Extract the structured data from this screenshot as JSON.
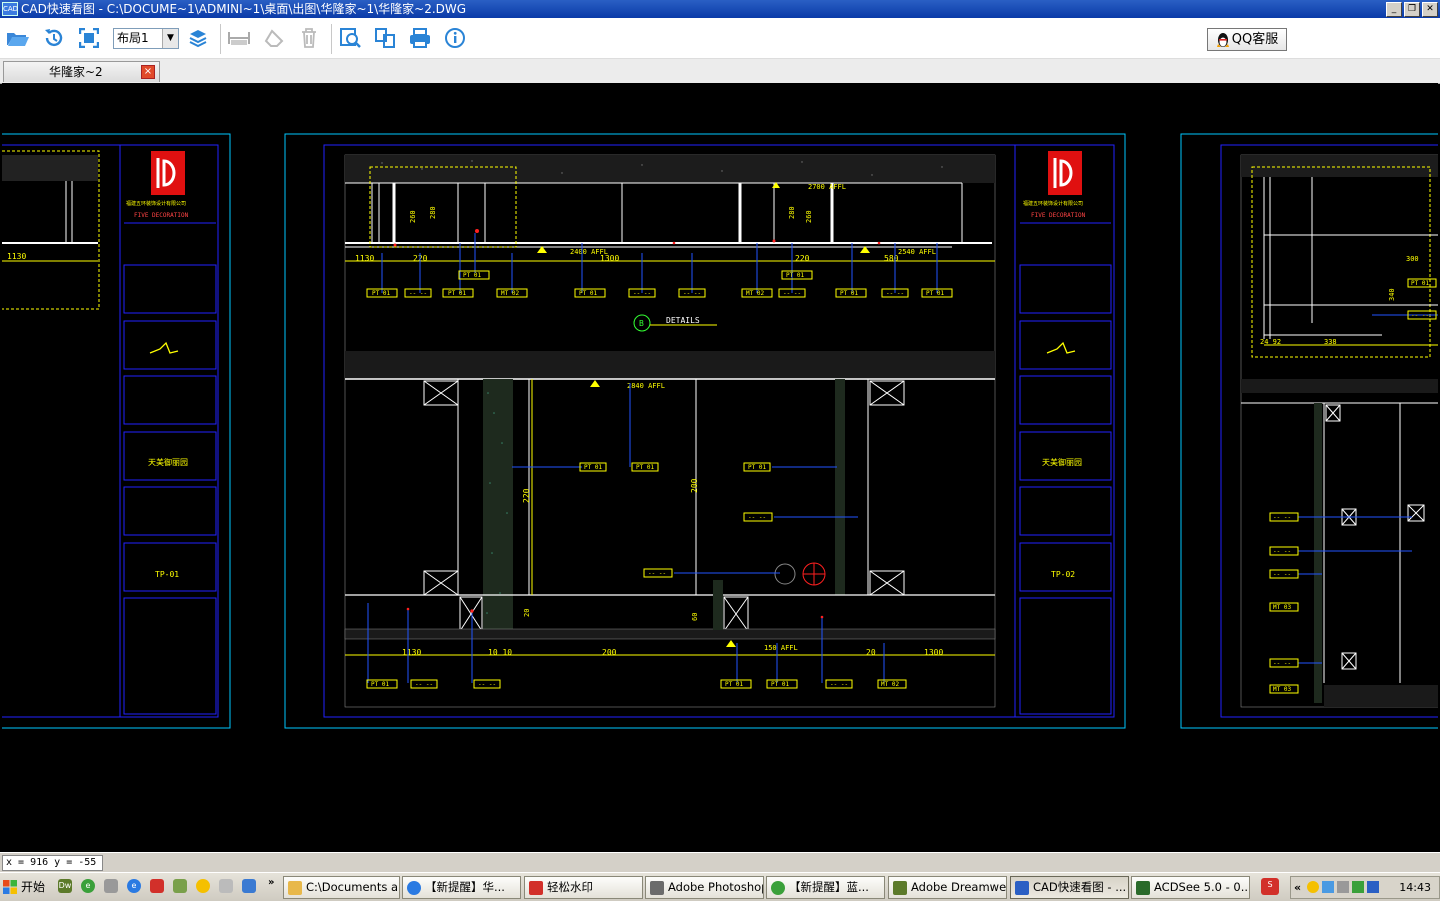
{
  "window": {
    "title": "CAD快速看图 - C:\\DOCUME~1\\ADMINI~1\\桌面\\出图\\华隆家~1\\华隆家~2.DWG",
    "app_icon": "CAD",
    "controls": [
      "minimize-icon",
      "restore-icon",
      "close-icon"
    ]
  },
  "toolbar": {
    "buttons": [
      {
        "name": "open-file",
        "icon": "folder-open-icon"
      },
      {
        "name": "refresh",
        "icon": "history-icon"
      },
      {
        "name": "fit-view",
        "icon": "fit-screen-icon"
      },
      {
        "name": "layers",
        "icon": "layers-icon"
      },
      {
        "name": "measure",
        "icon": "ruler-icon"
      },
      {
        "name": "erase",
        "icon": "eraser-icon"
      },
      {
        "name": "delete",
        "icon": "trash-icon"
      },
      {
        "name": "find-text",
        "icon": "search-text-icon"
      },
      {
        "name": "export",
        "icon": "export-icon"
      },
      {
        "name": "print",
        "icon": "printer-icon"
      },
      {
        "name": "about",
        "icon": "info-icon"
      }
    ],
    "layout_select": {
      "value": "布局1"
    },
    "qq_service": "QQ客服"
  },
  "tabs": [
    {
      "label": "华隆家~2",
      "active": true
    }
  ],
  "drawing": {
    "title_block": {
      "company_line": "FIVE DECORATION",
      "sheet_left": "TP-01",
      "sheet_right": "TP-02",
      "project_name": "天美御丽园"
    },
    "labels": {
      "details": "DETAILS",
      "details_mark": "B",
      "dim_1130": "1130",
      "dim_220": "220",
      "dim_1300": "1300",
      "dim_580": "580",
      "dim_200": "200",
      "dim_60": "60",
      "dim_20": "20",
      "dim_10_10": "10 10",
      "dim_260": "260",
      "dim_280": "280",
      "dim_300": "300",
      "dim_340": "340",
      "dim_338": "338",
      "dim_2492": "24 92",
      "level_2400": "2400 AFFL",
      "level_2540": "2540 AFFL",
      "level_2700": "2700 AFFL",
      "level_2840": "2840 AFFL",
      "level_150": "150 AFFL",
      "tag_pt01": "PT 01",
      "tag_mt02": "MT 02",
      "tag_mt03": "MT 03",
      "tag_dash": "-- --"
    }
  },
  "status": {
    "coordinates": "x = 916  y = -55"
  },
  "taskbar": {
    "start": "开始",
    "tasks": [
      {
        "label": "C:\\Documents a...",
        "icon": "folder-icon",
        "color": "#e8b84a"
      },
      {
        "label": "【新提醒】华...",
        "icon": "browser-icon",
        "color": "#2a7ae2"
      },
      {
        "label": "轻松水印",
        "icon": "watermark-icon",
        "color": "#d2302a"
      },
      {
        "label": "Adobe Photoshop",
        "icon": "photoshop-icon",
        "color": "#6b6b6b"
      },
      {
        "label": "【新提醒】蓝...",
        "icon": "browser-icon",
        "color": "#3aa03a"
      },
      {
        "label": "Adobe Dreamwe...",
        "icon": "dreamweaver-icon",
        "color": "#5c7a2a"
      },
      {
        "label": "CAD快速看图 - ...",
        "icon": "cad-icon",
        "color": "#2a5fc4",
        "active": true
      },
      {
        "label": "ACDSee 5.0 - 0...",
        "icon": "acdsee-icon",
        "color": "#2a6a2a"
      }
    ],
    "tray_chevron": "«",
    "clock": "14:43"
  }
}
